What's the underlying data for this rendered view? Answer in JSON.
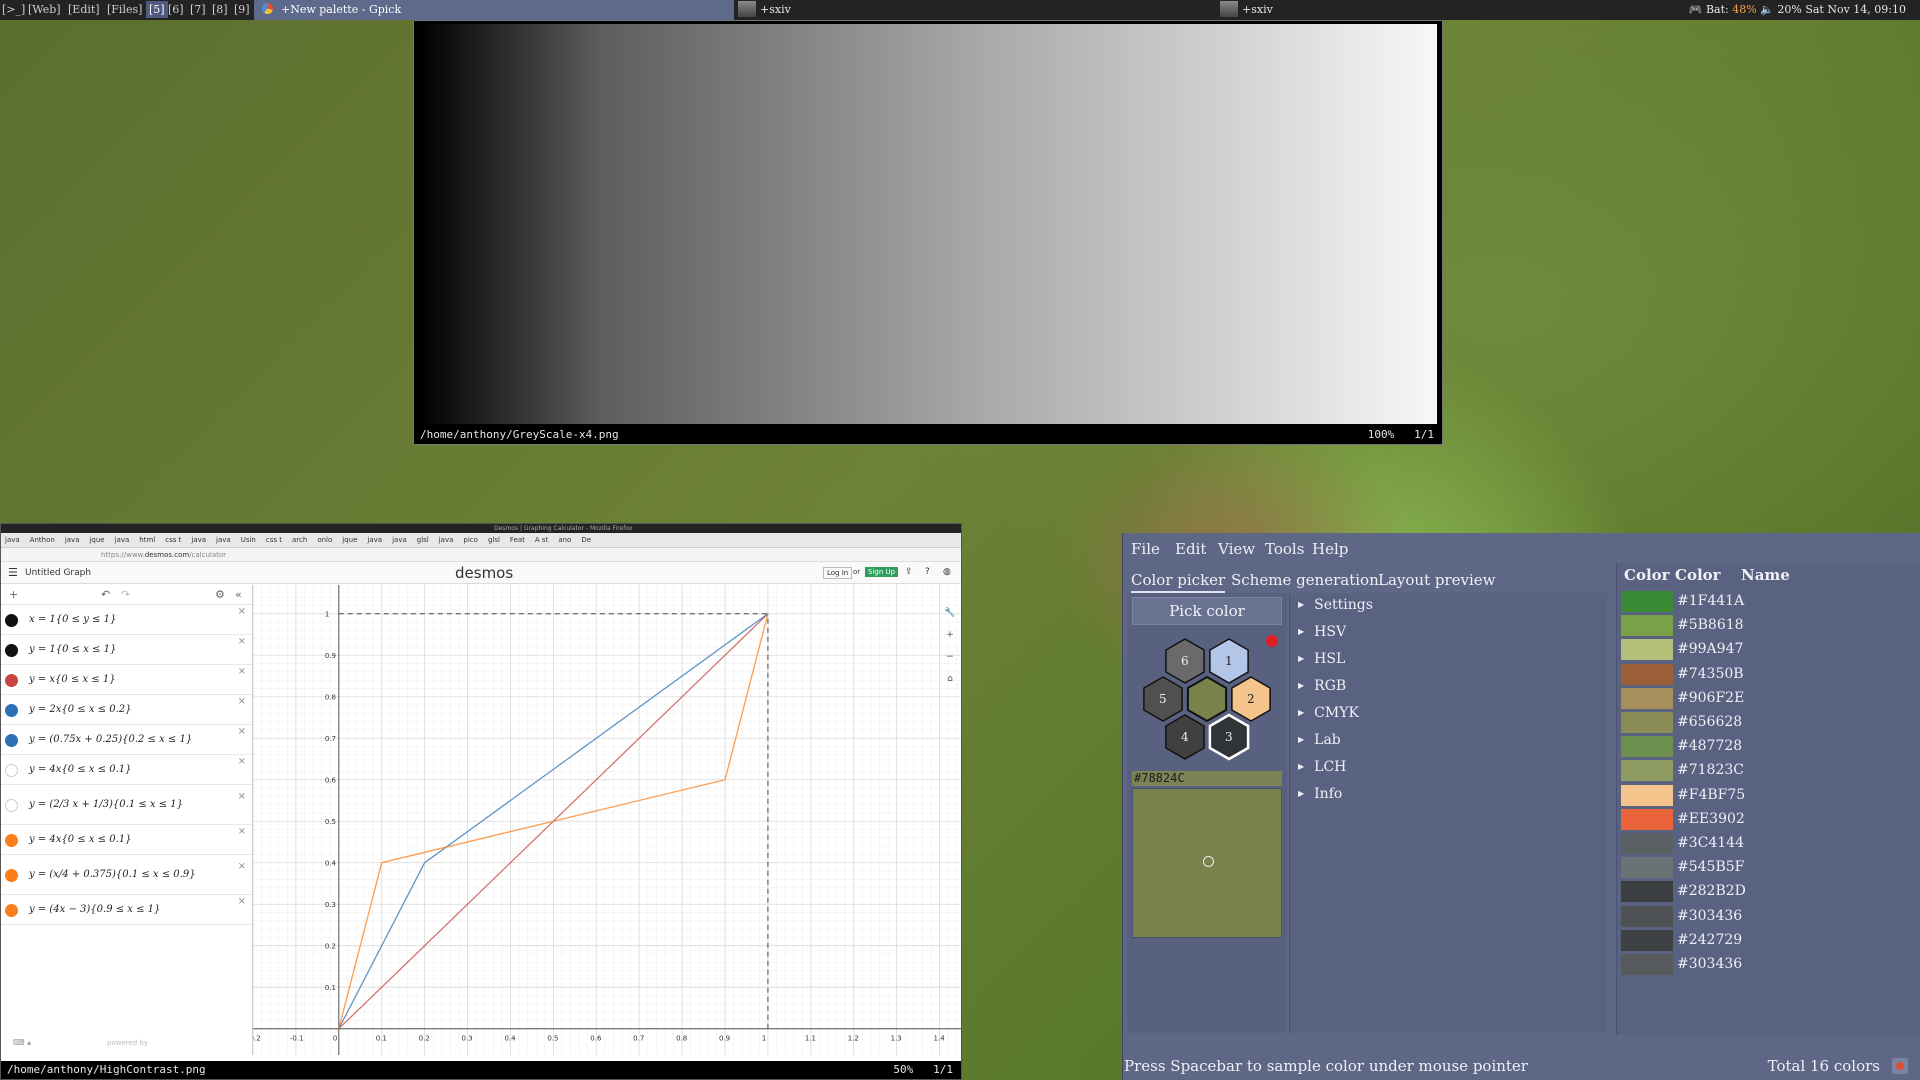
{
  "topbar": {
    "workspaces": [
      "[>_]",
      "[Web]",
      "[Edit]",
      "[Files]",
      "[5]",
      "[6]",
      "[7]",
      "[8]",
      "[9]"
    ],
    "active_window": "+New palette - Gpick",
    "sxiv1": "+sxiv",
    "sxiv2": "+sxiv",
    "battery_label": "Bat:",
    "battery": "48%",
    "volume": "20%",
    "datetime": "Sat Nov 14, 09:10"
  },
  "sxiv_top": {
    "path": "/home/anthony/GreyScale-x4.png",
    "zoom": "100%",
    "index": "1/1"
  },
  "sxiv_bottom": {
    "path": "/home/anthony/HighContrast.png",
    "zoom": "50%",
    "index": "1/1",
    "mini_tabs": [
      "java",
      "Anthon",
      "java",
      "jque",
      "java",
      "html",
      "css t",
      "java",
      "java",
      "Usin",
      "css t",
      "arch",
      "onlo",
      "jque",
      "java",
      "java",
      "glsl",
      "java",
      "pico",
      "glsl",
      "Feat",
      "A st",
      "ano",
      "De"
    ],
    "url_prefix": "https://www.",
    "url_domain": "desmos.com",
    "url_path": "/calculator",
    "window_title": "Desmos | Graphing Calculator - Mozilla Firefox",
    "desmos": {
      "graph_title": "Untitled Graph",
      "logo": "desmos",
      "login": "Log In",
      "or": "or",
      "signup": "Sign Up",
      "powered": "powered by",
      "expressions": [
        {
          "text": "x = 1{0 ≤ y ≤ 1}",
          "color": "#111111",
          "tall": false
        },
        {
          "text": "y = 1{0 ≤ x ≤ 1}",
          "color": "#111111",
          "tall": false
        },
        {
          "text": "y = x{0 ≤ x ≤ 1}",
          "color": "#c74440",
          "tall": false
        },
        {
          "text": "y = 2x{0 ≤ x ≤ 0.2}",
          "color": "#2d70b3",
          "tall": false
        },
        {
          "text": "y = (0.75x + 0.25){0.2 ≤ x ≤ 1}",
          "color": "#2d70b3",
          "tall": false
        },
        {
          "text": "y = 4x{0 ≤ x ≤ 0.1}",
          "color": "#ffffff",
          "tall": false
        },
        {
          "text": "y = (2/3 x + 1/3){0.1 ≤ x ≤ 1}",
          "color": "#ffffff",
          "tall": true
        },
        {
          "text": "y = 4x{0 ≤ x ≤ 0.1}",
          "color": "#fa7e19",
          "tall": false
        },
        {
          "text": "y = (x/4 + 0.375){0.1 ≤ x ≤ 0.9}",
          "color": "#fa7e19",
          "tall": true
        },
        {
          "text": "y = (4x − 3){0.9 ≤ x ≤ 1}",
          "color": "#fa7e19",
          "tall": false
        }
      ],
      "x_ticks": [
        "-0.2",
        "-0.1",
        "0",
        "0.1",
        "0.2",
        "0.3",
        "0.4",
        "0.5",
        "0.6",
        "0.7",
        "0.8",
        "0.9",
        "1",
        "1.1",
        "1.2",
        "1.3",
        "1.4"
      ],
      "y_ticks": [
        "0.1",
        "0.2",
        "0.3",
        "0.4",
        "0.5",
        "0.6",
        "0.7",
        "0.8",
        "0.9",
        "1"
      ]
    }
  },
  "chart_data": {
    "type": "line",
    "xlim": [
      -0.2,
      1.45
    ],
    "ylim": [
      -0.02,
      1.05
    ],
    "grid": true,
    "series": [
      {
        "color": "#c74440",
        "x": [
          0,
          1
        ],
        "y": [
          0,
          1
        ]
      },
      {
        "color": "#2d70b3",
        "x": [
          0,
          0.2,
          1
        ],
        "y": [
          0,
          0.4,
          1
        ]
      },
      {
        "color": "#fa7e19",
        "x": [
          0,
          0.1,
          0.9,
          1
        ],
        "y": [
          0,
          0.4,
          0.6,
          1
        ]
      }
    ],
    "guides": {
      "x": 1,
      "y": 1
    }
  },
  "gpick": {
    "menu": [
      "File",
      "Edit",
      "View",
      "Tools",
      "Help"
    ],
    "tabs": [
      "Color picker",
      "Scheme generation",
      "Layout preview"
    ],
    "pick_button": "Pick color",
    "hex_cells": [
      "6",
      "1",
      "5",
      "2",
      "4",
      "3"
    ],
    "hex_colors": [
      "#6a6a6a",
      "#b4c6e8",
      "#505050",
      "#f4c48c",
      "#404040",
      "#303436"
    ],
    "center_color": "#78824c",
    "current_hex": "#78824C",
    "sections": [
      "Settings",
      "HSV",
      "HSL",
      "RGB",
      "CMYK",
      "Lab",
      "LCH",
      "Info"
    ],
    "list_headers": [
      "Color",
      "Color",
      "Name"
    ],
    "palette": [
      {
        "hex": "#1F441A",
        "display": "#3a8a36"
      },
      {
        "hex": "#5B8618",
        "display": "#7aa048"
      },
      {
        "hex": "#99A947",
        "display": "#b4c07a"
      },
      {
        "hex": "#74350B",
        "display": "#9c6038"
      },
      {
        "hex": "#906F2E",
        "display": "#a78f5c"
      },
      {
        "hex": "#656628",
        "display": "#8a8c56"
      },
      {
        "hex": "#487728",
        "display": "#6d8f4e"
      },
      {
        "hex": "#71823C",
        "display": "#8e9c62"
      },
      {
        "hex": "#F4BF75",
        "display": "#f4c48c"
      },
      {
        "hex": "#EE3902",
        "display": "#e9643a"
      },
      {
        "hex": "#3C4144",
        "display": "#5b6064"
      },
      {
        "hex": "#545B5F",
        "display": "#6b7276"
      },
      {
        "hex": "#282B2D",
        "display": "#3c3f42"
      },
      {
        "hex": "#303436",
        "display": "#4e5254"
      },
      {
        "hex": "#242729",
        "display": "#3e4144"
      },
      {
        "hex": "#303436",
        "display": "#565a5c"
      }
    ],
    "status": "Press Spacebar to sample color under mouse pointer",
    "total": "Total 16 colors"
  }
}
